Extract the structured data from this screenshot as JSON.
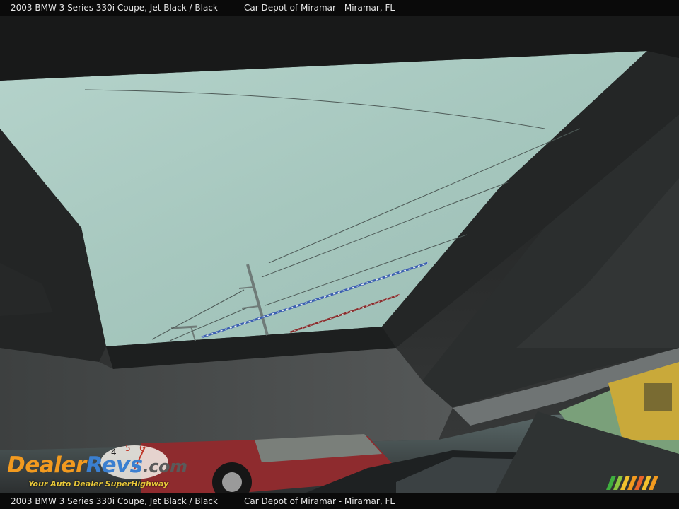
{
  "header": {
    "vehicle_title": "2003 BMW 3 Series 330i Coupe,   Jet Black / Black",
    "dealer": "Car Depot of Miramar - Miramar, FL"
  },
  "footer": {
    "vehicle_title": "2003 BMW 3 Series 330i Coupe,   Jet Black / Black",
    "dealer": "Car Depot of Miramar - Miramar, FL"
  },
  "watermark": {
    "brand_left": "Dealer",
    "brand_right": "Revs",
    "brand_suffix": ".com",
    "tagline": "Your Auto Dealer SuperHighway",
    "dial_digits": [
      "4",
      "5",
      "6"
    ]
  },
  "colors": {
    "brand_orange": "#f29a1f",
    "brand_blue": "#3a7fd0",
    "tagline_yellow": "#e8c83a",
    "sky": "#a9c9c0",
    "headliner": "#2a2c2c"
  },
  "photo": {
    "subject": "sunroof-interior-view"
  }
}
